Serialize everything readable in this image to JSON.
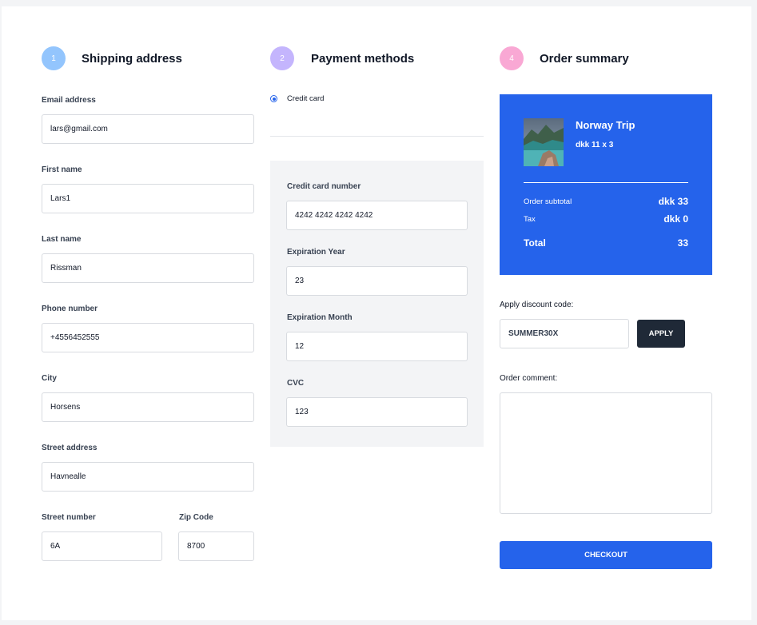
{
  "shipping": {
    "step": "1",
    "title": "Shipping address",
    "email_label": "Email address",
    "email_value": "lars@gmail.com",
    "first_name_label": "First name",
    "first_name_value": "Lars1",
    "last_name_label": "Last name",
    "last_name_value": "Rissman",
    "phone_label": "Phone number",
    "phone_value": "+4556452555",
    "city_label": "City",
    "city_value": "Horsens",
    "street_label": "Street address",
    "street_value": "Havnealle",
    "street_number_label": "Street number",
    "street_number_value": "6A",
    "zip_label": "Zip Code",
    "zip_value": "8700"
  },
  "payment": {
    "step": "2",
    "title": "Payment methods",
    "method_label": "Credit card",
    "card_number_label": "Credit card number",
    "card_number_value": "4242 4242 4242 4242",
    "exp_year_label": "Expiration Year",
    "exp_year_value": "23",
    "exp_month_label": "Expiration Month",
    "exp_month_value": "12",
    "cvc_label": "CVC",
    "cvc_value": "123"
  },
  "summary": {
    "step": "4",
    "title": "Order summary",
    "product_name": "Norway Trip",
    "product_price": "dkk 11 x 3",
    "subtotal_label": "Order subtotal",
    "subtotal_value": "dkk 33",
    "tax_label": "Tax",
    "tax_value": "dkk 0",
    "total_label": "Total",
    "total_value": "33",
    "discount_label": "Apply discount code:",
    "discount_value": "SUMMER30X",
    "apply_label": "APPLY",
    "comment_label": "Order comment:",
    "comment_value": "",
    "checkout_label": "CHECKOUT"
  },
  "colors": {
    "step1": "#93c5fd",
    "step2": "#c4b5fd",
    "step4": "#f9a8d4",
    "accent": "#2563eb",
    "dark_button": "#1f2937",
    "panel_bg": "#f3f4f6"
  }
}
